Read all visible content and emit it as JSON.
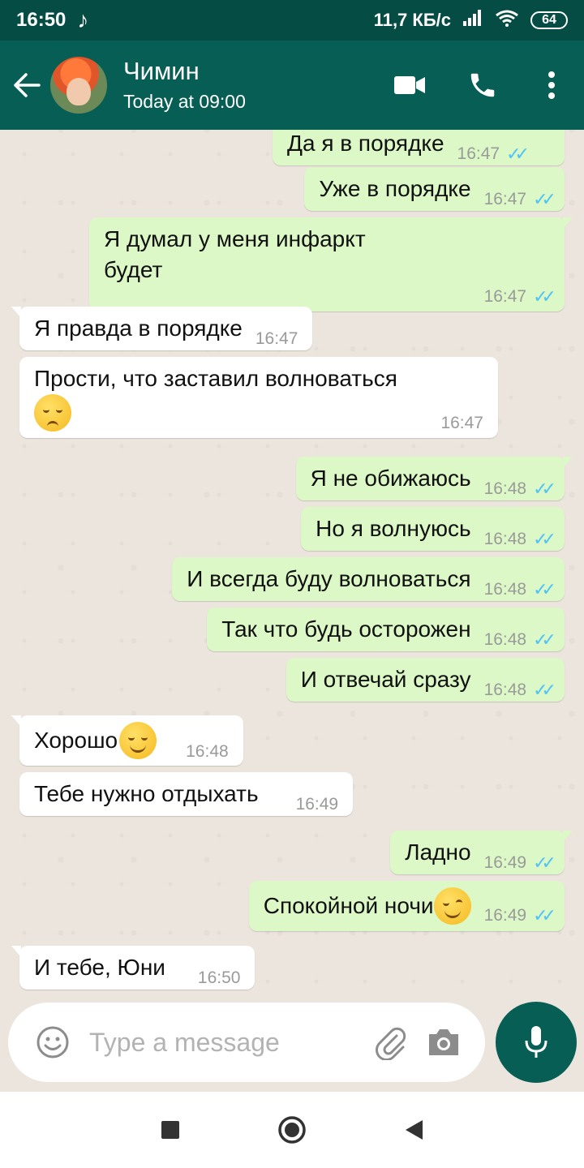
{
  "status_bar": {
    "time": "16:50",
    "music_icon": "♪",
    "network_speed": "11,7 КБ/с",
    "battery_level": "64"
  },
  "header": {
    "contact_name": "Чимин",
    "contact_status": "Today at 09:00",
    "icons": [
      "back-arrow-icon",
      "avatar",
      "video-call-icon",
      "phone-icon",
      "more-options-icon"
    ]
  },
  "messages": [
    {
      "direction": "out",
      "text": "Да я в порядке",
      "time": "16:47",
      "read": true
    },
    {
      "direction": "out",
      "text": "Уже в порядке",
      "time": "16:47",
      "read": true
    },
    {
      "direction": "out",
      "text": "Я думал у меня инфаркт\nбудет",
      "time": "16:47",
      "read": true
    },
    {
      "direction": "in",
      "text": "Я правда в порядке",
      "time": "16:47"
    },
    {
      "direction": "in",
      "text": "Прости, что заставил волноваться",
      "emoji": "pensive",
      "time": "16:47"
    },
    {
      "direction": "out",
      "text": "Я не обижаюсь",
      "time": "16:48",
      "read": true
    },
    {
      "direction": "out",
      "text": "Но я волнуюсь",
      "time": "16:48",
      "read": true
    },
    {
      "direction": "out",
      "text": "И всегда буду волноваться",
      "time": "16:48",
      "read": true
    },
    {
      "direction": "out",
      "text": "Так что будь осторожен",
      "time": "16:48",
      "read": true
    },
    {
      "direction": "out",
      "text": "И отвечай сразу",
      "time": "16:48",
      "read": true
    },
    {
      "direction": "in",
      "text": "Хорошо",
      "emoji": "smiling",
      "time": "16:48"
    },
    {
      "direction": "in",
      "text": "Тебе нужно отдыхать",
      "time": "16:49"
    },
    {
      "direction": "out",
      "text": "Ладно",
      "time": "16:49",
      "read": true
    },
    {
      "direction": "out",
      "text": "Спокойной ночи",
      "emoji": "winking",
      "time": "16:49",
      "read": true
    },
    {
      "direction": "in",
      "text": "И тебе, Юни",
      "time": "16:50"
    }
  ],
  "composer": {
    "placeholder": "Type a message",
    "value": ""
  },
  "colors": {
    "header": "#075e54",
    "status_bar": "#054d44",
    "outgoing_bubble": "#dcf8c6",
    "incoming_bubble": "#ffffff",
    "read_ticks": "#4fc3f7",
    "chat_background": "#ece5dd"
  }
}
